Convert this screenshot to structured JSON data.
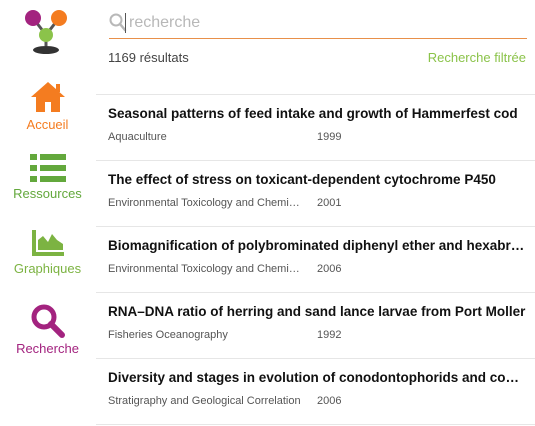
{
  "colors": {
    "accueil": "#f47c20",
    "ressources": "#63a83c",
    "graphiques": "#7cb342",
    "recherche": "#a3237f",
    "filter_link": "#8bc34a",
    "search_underline": "#e8904a"
  },
  "logo": {
    "icon": "molecule-logo"
  },
  "nav": {
    "accueil": {
      "label": "Accueil",
      "icon": "home-icon"
    },
    "ressources": {
      "label": "Ressources",
      "icon": "list-icon"
    },
    "graphiques": {
      "label": "Graphiques",
      "icon": "area-chart-icon"
    },
    "recherche": {
      "label": "Recherche",
      "icon": "search-icon"
    }
  },
  "search": {
    "placeholder": "recherche",
    "value": ""
  },
  "results_count": "1169 résultats",
  "filter_link": "Recherche filtrée",
  "results": [
    {
      "title": "Seasonal patterns of feed intake and growth of Hammerfest cod",
      "journal": "Aquaculture",
      "year": "1999"
    },
    {
      "title": "The effect of stress on toxicant-dependent cytochrome P450",
      "journal": "Environmental Toxicology and Chemistry",
      "year": "2001"
    },
    {
      "title": "Biomagnification of polybrominated diphenyl ether and hexabromocyclododecane",
      "journal": "Environmental Toxicology and Chemistry",
      "year": "2006"
    },
    {
      "title": "RNA–DNA ratio of herring and sand lance larvae from Port Moller",
      "journal": "Fisheries Oceanography",
      "year": "1992"
    },
    {
      "title": "Diversity and stages in evolution of conodontophorids and conodonts",
      "journal": "Stratigraphy and Geological Correlation",
      "year": "2006"
    }
  ]
}
